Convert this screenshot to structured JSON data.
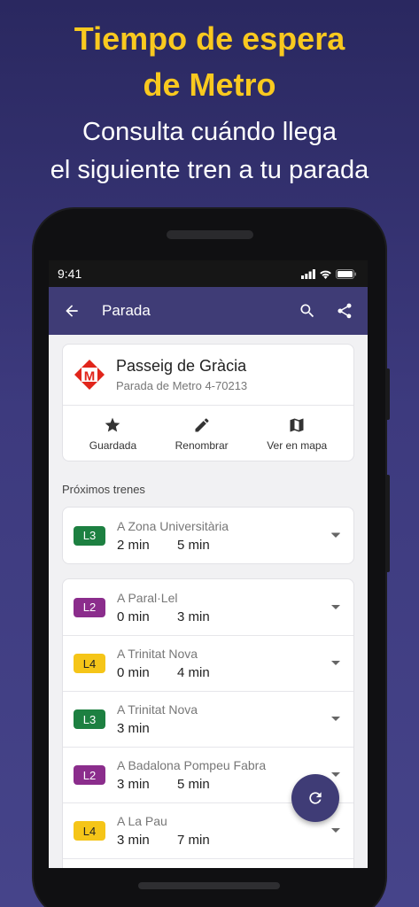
{
  "promo": {
    "title_line1": "Tiempo de espera",
    "title_line2": "de Metro",
    "subtitle_line1": "Consulta cuándo llega",
    "subtitle_line2": "el siguiente tren a tu parada"
  },
  "status_bar": {
    "time": "9:41"
  },
  "app_bar": {
    "title": "Parada",
    "back_icon": "arrow-back-icon",
    "search_icon": "search-icon",
    "share_icon": "share-icon"
  },
  "stop": {
    "name": "Passeig de Gràcia",
    "code": "Parada de Metro 4-70213",
    "logo_letter": "M",
    "actions": [
      {
        "label": "Guardada",
        "icon": "star-icon"
      },
      {
        "label": "Renombrar",
        "icon": "pencil-icon"
      },
      {
        "label": "Ver en mapa",
        "icon": "map-icon"
      }
    ]
  },
  "section": {
    "title": "Próximos trenes"
  },
  "colors": {
    "L2": "#8b2d8c",
    "L3": "#1d8041",
    "L4": "#f5c518",
    "primary": "#3f3c76",
    "accent": "#f9c91f"
  },
  "trains_group1": [
    {
      "line": "L3",
      "destination": "A Zona Universitària",
      "time1": "2 min",
      "time2": "5 min"
    }
  ],
  "trains_group2": [
    {
      "line": "L2",
      "destination": "A Paral·Lel",
      "time1": "0 min",
      "time2": "3 min"
    },
    {
      "line": "L4",
      "destination": "A Trinitat Nova",
      "time1": "0 min",
      "time2": "4 min"
    },
    {
      "line": "L3",
      "destination": "A Trinitat Nova",
      "time1": "3 min",
      "time2": ""
    },
    {
      "line": "L2",
      "destination": "A Badalona Pompeu Fabra",
      "time1": "3 min",
      "time2": "5 min"
    },
    {
      "line": "L4",
      "destination": "A La Pau",
      "time1": "3 min",
      "time2": "7 min"
    }
  ]
}
